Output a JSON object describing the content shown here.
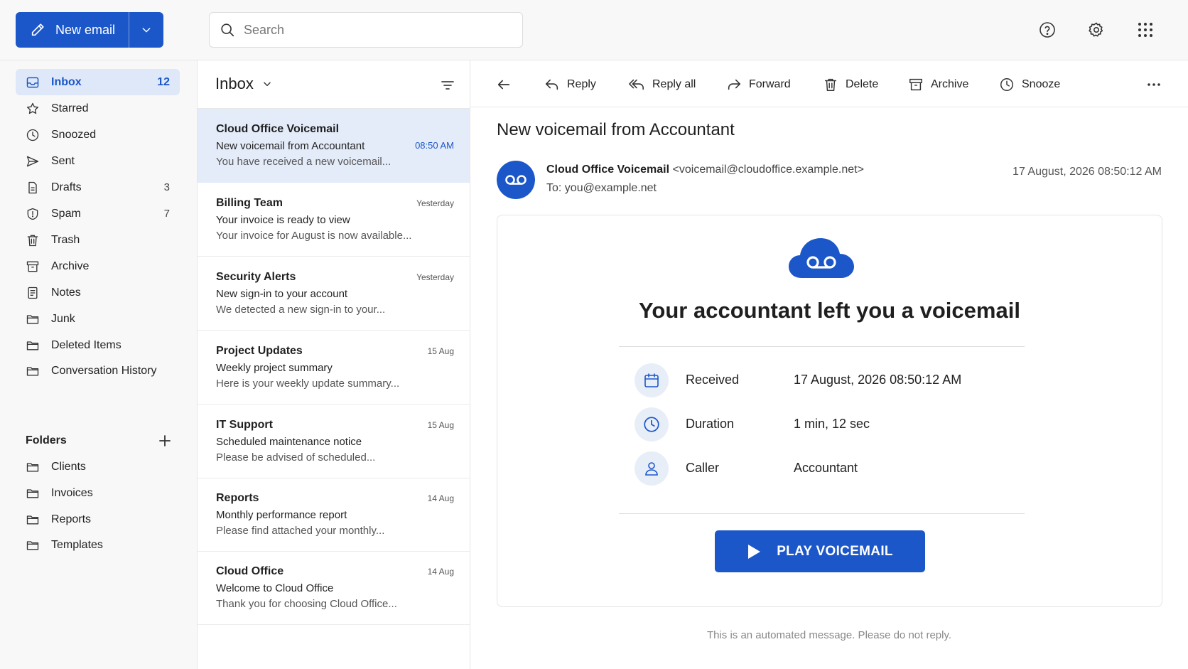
{
  "colors": {
    "accent": "#1b57c9",
    "selected_bg": "#e4ecfa",
    "sidebar_bg": "#f8f8f8"
  },
  "compose": {
    "label": "New email",
    "pencil_icon": "pencil-icon",
    "dropdown_icon": "chevron-down-icon"
  },
  "search": {
    "placeholder": "Search",
    "icon": "search-icon"
  },
  "header_icons": [
    "help-icon",
    "gear-icon",
    "app-grid-icon"
  ],
  "sidebar": {
    "items": [
      {
        "label": "Inbox",
        "count": "12",
        "icon": "inbox-icon",
        "active": true
      },
      {
        "label": "Starred",
        "count": "",
        "icon": "star-icon"
      },
      {
        "label": "Snoozed",
        "count": "",
        "icon": "clock-icon"
      },
      {
        "label": "Sent",
        "count": "",
        "icon": "send-icon"
      },
      {
        "label": "Drafts",
        "count": "3",
        "icon": "draft-icon"
      },
      {
        "label": "Spam",
        "count": "7",
        "icon": "shield-icon"
      },
      {
        "label": "Trash",
        "count": "",
        "icon": "trash-icon"
      },
      {
        "label": "Archive",
        "count": "",
        "icon": "archive-icon"
      },
      {
        "label": "Notes",
        "count": "",
        "icon": "note-icon"
      },
      {
        "label": "Junk",
        "count": "",
        "icon": "folder-icon"
      },
      {
        "label": "Deleted Items",
        "count": "",
        "icon": "folder-icon"
      },
      {
        "label": "Conversation History",
        "count": "",
        "icon": "folder-icon"
      }
    ],
    "folders_title": "Folders",
    "folders": [
      {
        "label": "Clients",
        "icon": "folder-icon"
      },
      {
        "label": "Invoices",
        "icon": "folder-icon"
      },
      {
        "label": "Reports",
        "icon": "folder-icon"
      },
      {
        "label": "Templates",
        "icon": "folder-icon"
      }
    ]
  },
  "list": {
    "title": "Inbox",
    "messages": [
      {
        "sender": "Cloud Office Voicemail",
        "subject": "New voicemail from Accountant",
        "preview": "You have received a new voicemail...",
        "time": "08:50 AM",
        "selected": true
      },
      {
        "sender": "Billing Team",
        "subject": "Your invoice is ready to view",
        "preview": "Your invoice for August is now available...",
        "time": "Yesterday"
      },
      {
        "sender": "Security Alerts",
        "subject": "New sign-in to your account",
        "preview": "We detected a new sign-in to your...",
        "time": "Yesterday"
      },
      {
        "sender": "Project Updates",
        "subject": "Weekly project summary",
        "preview": "Here is your weekly update summary...",
        "time": "15 Aug"
      },
      {
        "sender": "IT Support",
        "subject": "Scheduled maintenance notice",
        "preview": "Please be advised of scheduled...",
        "time": "15 Aug"
      },
      {
        "sender": "Reports",
        "subject": "Monthly performance report",
        "preview": "Please find attached your monthly...",
        "time": "14 Aug"
      },
      {
        "sender": "Cloud Office",
        "subject": "Welcome to Cloud Office",
        "preview": "Thank you for choosing Cloud Office...",
        "time": "14 Aug"
      }
    ]
  },
  "toolbar": {
    "back_icon": "arrow-left-icon",
    "reply": "Reply",
    "reply_all": "Reply all",
    "forward": "Forward",
    "delete": "Delete",
    "archive": "Archive",
    "snooze": "Snooze",
    "more_icon": "more-horizontal-icon"
  },
  "email": {
    "subject": "New voicemail from Accountant",
    "from_name": "Cloud Office Voicemail",
    "from_address": "<voicemail@cloudoffice.example.net>",
    "to_label": "To:",
    "to_address": "you@example.net",
    "date": "17 August, 2026 08:50:12 AM",
    "avatar_icon": "voicemail-icon",
    "body": {
      "logo_icon": "cloud-voicemail-icon",
      "heading": "Your accountant left you a voicemail",
      "details": [
        {
          "key": "Received",
          "value": "17 August, 2026 08:50:12 AM",
          "icon": "calendar-icon"
        },
        {
          "key": "Duration",
          "value": "1 min, 12 sec",
          "icon": "clock-icon"
        },
        {
          "key": "Caller",
          "value": "Accountant",
          "icon": "person-icon"
        }
      ],
      "play_button": "PLAY VOICEMAIL",
      "play_icon": "play-icon"
    },
    "footer_note": "This is an automated message. Please do not reply."
  }
}
